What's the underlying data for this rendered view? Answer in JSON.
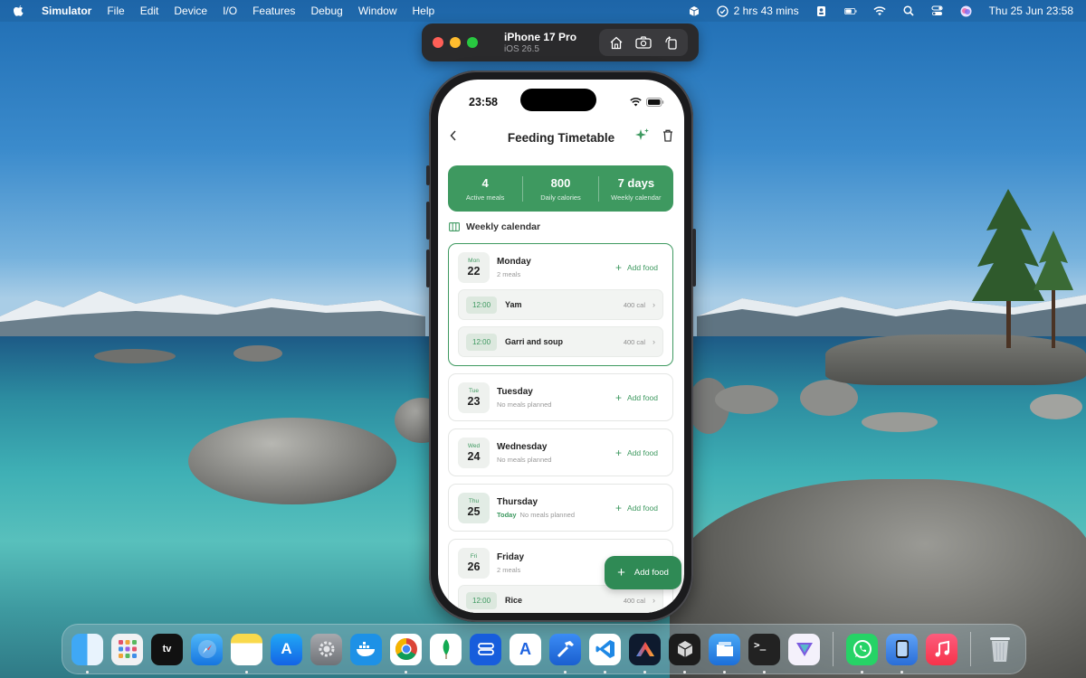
{
  "menubar": {
    "app_name": "Simulator",
    "items": [
      "File",
      "Edit",
      "Device",
      "I/O",
      "Features",
      "Debug",
      "Window",
      "Help"
    ],
    "battery_time": "2 hrs 43 mins",
    "datetime": "Thu 25 Jun  23:58"
  },
  "simulator": {
    "device": "iPhone 17 Pro",
    "os": "iOS 26.5"
  },
  "phone": {
    "status_time": "23:58",
    "nav": {
      "title": "Feeding Timetable"
    },
    "stats": [
      {
        "value": "4",
        "label": "Active meals"
      },
      {
        "value": "800",
        "label": "Daily calories"
      },
      {
        "value": "7 days",
        "label": "Weekly calendar"
      }
    ],
    "section_title": "Weekly calendar",
    "add_food_label": "Add food",
    "days": [
      {
        "abbr": "Mon",
        "num": "22",
        "name": "Monday",
        "sub": "2 meals",
        "today": "",
        "meals": [
          {
            "time": "12:00",
            "name": "Yam",
            "cal": "400 cal"
          },
          {
            "time": "12:00",
            "name": "Garri and soup",
            "cal": "400 cal"
          }
        ]
      },
      {
        "abbr": "Tue",
        "num": "23",
        "name": "Tuesday",
        "sub": "No meals planned",
        "today": ""
      },
      {
        "abbr": "Wed",
        "num": "24",
        "name": "Wednesday",
        "sub": "No meals planned",
        "today": ""
      },
      {
        "abbr": "Thu",
        "num": "25",
        "name": "Thursday",
        "sub": "No meals planned",
        "today": "Today"
      },
      {
        "abbr": "Fri",
        "num": "26",
        "name": "Friday",
        "sub": "2 meals",
        "today": "",
        "meals": [
          {
            "time": "12:00",
            "name": "Rice",
            "cal": "400 cal"
          }
        ]
      }
    ],
    "fab_label": "Add food"
  },
  "colors": {
    "accent_green": "#3e9960",
    "fab_green": "#2f8a55"
  },
  "dock": {
    "apps": [
      "finder-icon",
      "launchpad-icon",
      "apple-tv-icon",
      "safari-icon",
      "notes-icon",
      "app-store-icon",
      "system-settings-icon",
      "docker-icon",
      "chrome-icon",
      "mongodb-icon",
      "bitwarden-icon",
      "altstore-icon",
      "xcode-icon",
      "vscode-icon",
      "antigravity-icon",
      "cursor-icon",
      "files-icon",
      "terminal-icon",
      "proton-vpn-icon",
      "whatsapp-icon",
      "simulator-icon",
      "music-icon",
      "trash-icon"
    ]
  }
}
